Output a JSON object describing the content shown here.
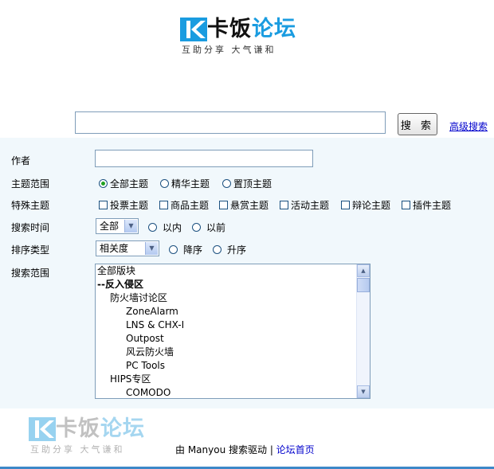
{
  "logo": {
    "name_part1": "卡饭",
    "name_part2": "论坛",
    "slogan": "互助分享  大气谦和"
  },
  "search": {
    "query": "",
    "button_label": "搜 索",
    "advanced_link": "高级搜索"
  },
  "form": {
    "author": {
      "label": "作者",
      "value": ""
    },
    "thread_scope": {
      "label": "主题范围",
      "options": [
        "全部主题",
        "精华主题",
        "置顶主题"
      ],
      "selected": "全部主题"
    },
    "special_threads": {
      "label": "特殊主题",
      "options": [
        "投票主题",
        "商品主题",
        "悬赏主题",
        "活动主题",
        "辩论主题",
        "插件主题"
      ]
    },
    "search_time": {
      "label": "搜索时间",
      "selected": "全部",
      "options": [
        "以内",
        "以前"
      ]
    },
    "sort_type": {
      "label": "排序类型",
      "selected": "相关度",
      "options": [
        "降序",
        "升序"
      ]
    },
    "forum_scope": {
      "label": "搜索范围",
      "items": [
        {
          "text": "全部版块",
          "level": 0,
          "bold": false
        },
        {
          "text": "--反入侵区",
          "level": 0,
          "bold": true
        },
        {
          "text": "防火墙讨论区",
          "level": 1,
          "bold": false
        },
        {
          "text": "ZoneAlarm",
          "level": 2,
          "bold": false
        },
        {
          "text": "LNS & CHX-I",
          "level": 2,
          "bold": false
        },
        {
          "text": "Outpost",
          "level": 2,
          "bold": false
        },
        {
          "text": "风云防火墙",
          "level": 2,
          "bold": false
        },
        {
          "text": "PC Tools",
          "level": 2,
          "bold": false
        },
        {
          "text": "HIPS专区",
          "level": 1,
          "bold": false
        },
        {
          "text": "COMODO",
          "level": 2,
          "bold": false
        }
      ]
    }
  },
  "footer": {
    "powered_by": "由 Manyou 搜索驱动",
    "separator": " | ",
    "home_link": "论坛首页"
  }
}
